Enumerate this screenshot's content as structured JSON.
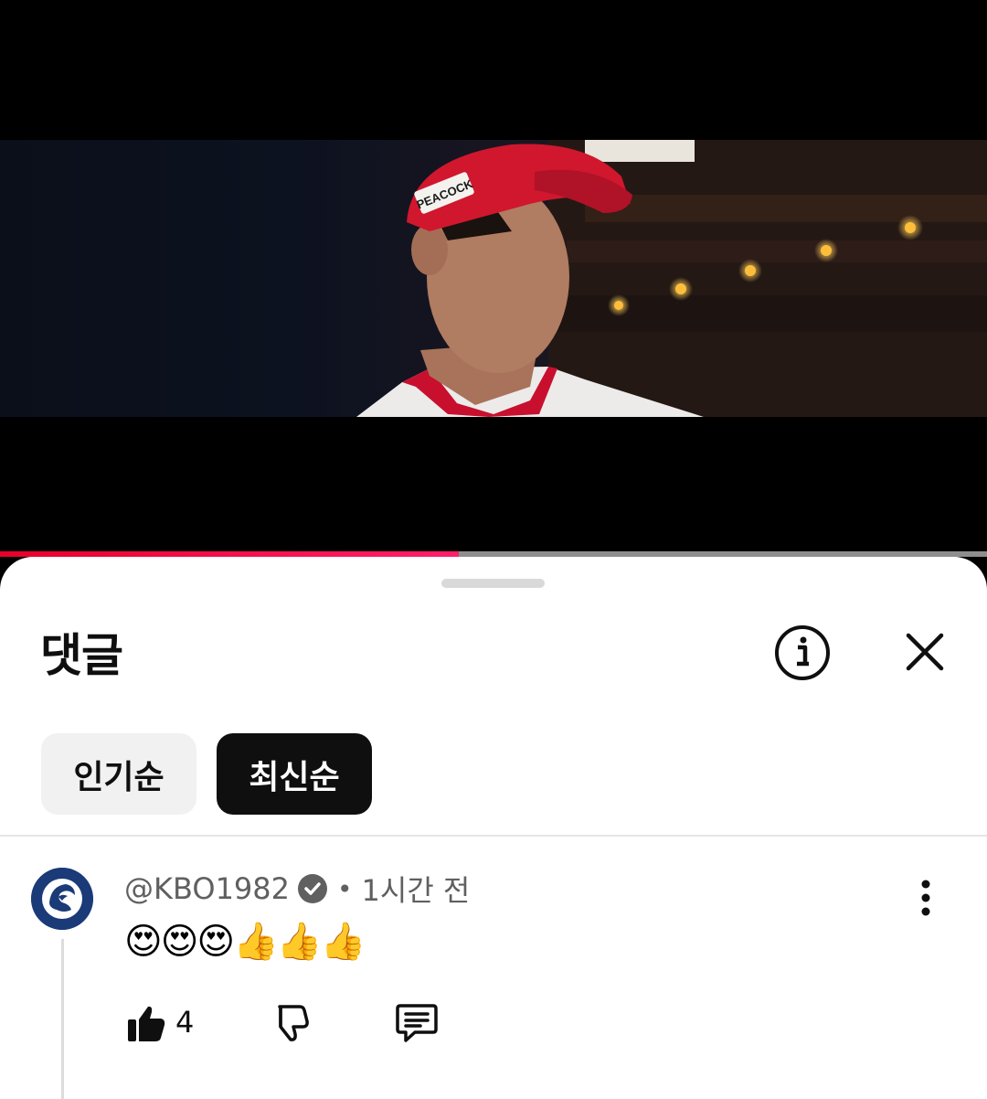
{
  "video": {
    "progress": 0.465,
    "cap_text": "PEACOCK"
  },
  "comments_panel": {
    "title": "댓글",
    "info_icon": "info-circle-icon",
    "close_icon": "close-x-icon",
    "sort_chips": [
      {
        "label": "인기순",
        "selected": false
      },
      {
        "label": "최신순",
        "selected": true
      }
    ]
  },
  "comment": {
    "author": "@KBO1982",
    "verified": true,
    "separator": "•",
    "time": "1시간 전",
    "text": "😍😍😍👍👍👍",
    "like_count": "4",
    "icons": {
      "like": "thumbs-up-filled-icon",
      "dislike": "thumbs-down-outline-icon",
      "reply": "comment-reply-icon",
      "more": "vertical-dots-menu-icon"
    }
  },
  "colors": {
    "progress": "#e8002a",
    "chip_selected_bg": "#0f0f0f",
    "chip_bg": "#f1f1f1",
    "avatar_bg": "#1a3a78"
  }
}
